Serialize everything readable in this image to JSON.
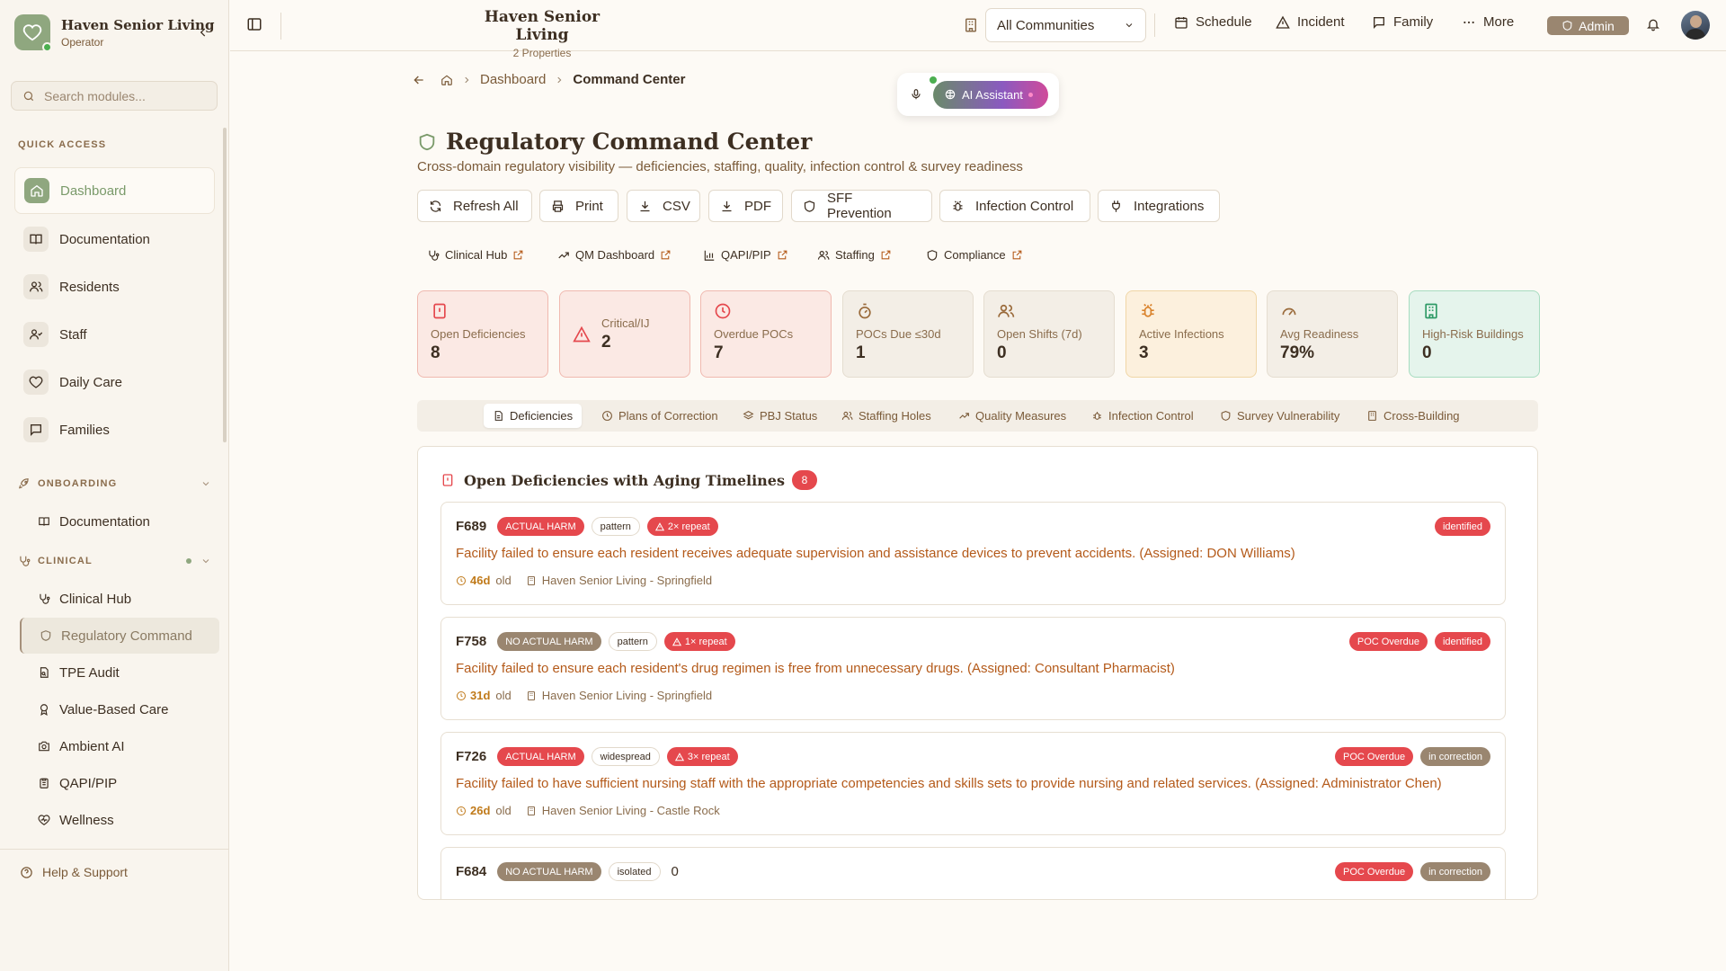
{
  "brand": {
    "name": "Haven Senior Living",
    "role": "Operator"
  },
  "search": {
    "placeholder": "Search modules..."
  },
  "quick_access": {
    "title": "QUICK ACCESS",
    "items": [
      {
        "label": "Dashboard",
        "icon": "home-icon"
      },
      {
        "label": "Documentation",
        "icon": "book-icon"
      },
      {
        "label": "Residents",
        "icon": "users-icon"
      },
      {
        "label": "Staff",
        "icon": "staff-icon"
      },
      {
        "label": "Daily Care",
        "icon": "heart-icon"
      },
      {
        "label": "Families",
        "icon": "message-icon"
      }
    ]
  },
  "onboarding": {
    "title": "ONBOARDING",
    "items": [
      {
        "label": "Documentation"
      }
    ]
  },
  "clinical": {
    "title": "CLINICAL",
    "items": [
      {
        "label": "Clinical Hub"
      },
      {
        "label": "Regulatory Command"
      },
      {
        "label": "TPE Audit"
      },
      {
        "label": "Value-Based Care"
      },
      {
        "label": "Ambient AI"
      },
      {
        "label": "QAPI/PIP"
      },
      {
        "label": "Wellness"
      }
    ]
  },
  "help": "Help & Support",
  "header": {
    "title": "Haven Senior Living",
    "subtitle": "2 Properties",
    "community": "All Communities",
    "schedule": "Schedule",
    "incident": "Incident",
    "family": "Family",
    "more": "More",
    "admin": "Admin"
  },
  "breadcrumb": {
    "dashboard": "Dashboard",
    "current": "Command Center"
  },
  "ai": {
    "label": "AI Assistant"
  },
  "page": {
    "title": "Regulatory Command Center",
    "subtitle": "Cross-domain regulatory visibility — deficiencies, staffing, quality, infection control & survey readiness"
  },
  "actions": [
    "Refresh All",
    "Print",
    "CSV",
    "PDF",
    "SFF Prevention",
    "Infection Control",
    "Integrations"
  ],
  "links": [
    "Clinical Hub",
    "QM Dashboard",
    "QAPI/PIP",
    "Staffing",
    "Compliance"
  ],
  "kpis": [
    {
      "label": "Open Deficiencies",
      "value": "8",
      "tone": "red"
    },
    {
      "label": "Critical/IJ",
      "value": "2",
      "tone": "red"
    },
    {
      "label": "Overdue POCs",
      "value": "7",
      "tone": "red"
    },
    {
      "label": "POCs Due ≤30d",
      "value": "1",
      "tone": "neutral"
    },
    {
      "label": "Open Shifts (7d)",
      "value": "0",
      "tone": "neutral"
    },
    {
      "label": "Active Infections",
      "value": "3",
      "tone": "amber"
    },
    {
      "label": "Avg Readiness",
      "value": "79%",
      "tone": "neutral"
    },
    {
      "label": "High-Risk Buildings",
      "value": "0",
      "tone": "green"
    }
  ],
  "tabs": [
    "Deficiencies",
    "Plans of Correction",
    "PBJ Status",
    "Staffing Holes",
    "Quality Measures",
    "Infection Control",
    "Survey Vulnerability",
    "Cross-Building"
  ],
  "panel": {
    "title": "Open Deficiencies with Aging Timelines",
    "count": "8"
  },
  "deficiencies": [
    {
      "tag": "F689",
      "harm": "ACTUAL HARM",
      "scope": "pattern",
      "repeat": "2× repeat",
      "poc": "",
      "status": "identified",
      "desc": "Facility failed to ensure each resident receives adequate supervision and assistance devices to prevent accidents. (Assigned: DON Williams)",
      "age": "46d",
      "age_suffix": "old",
      "facility": "Haven Senior Living - Springfield"
    },
    {
      "tag": "F758",
      "harm": "NO ACTUAL HARM",
      "scope": "pattern",
      "repeat": "1× repeat",
      "poc": "POC Overdue",
      "status": "identified",
      "desc": "Facility failed to ensure each resident's drug regimen is free from unnecessary drugs. (Assigned: Consultant Pharmacist)",
      "age": "31d",
      "age_suffix": "old",
      "facility": "Haven Senior Living - Springfield"
    },
    {
      "tag": "F726",
      "harm": "ACTUAL HARM",
      "scope": "widespread",
      "repeat": "3× repeat",
      "poc": "POC Overdue",
      "status": "in correction",
      "desc": "Facility failed to have sufficient nursing staff with the appropriate competencies and skills sets to provide nursing and related services. (Assigned: Administrator Chen)",
      "age": "26d",
      "age_suffix": "old",
      "facility": "Haven Senior Living - Castle Rock"
    },
    {
      "tag": "F684",
      "harm": "NO ACTUAL HARM",
      "scope": "isolated",
      "repeat_count": "0",
      "poc": "POC Overdue",
      "status": "in correction"
    }
  ],
  "colors": {
    "accent": "#8fa77f",
    "danger": "#e5484d",
    "muted": "#9a8670",
    "orange_text": "#b45a1a"
  }
}
